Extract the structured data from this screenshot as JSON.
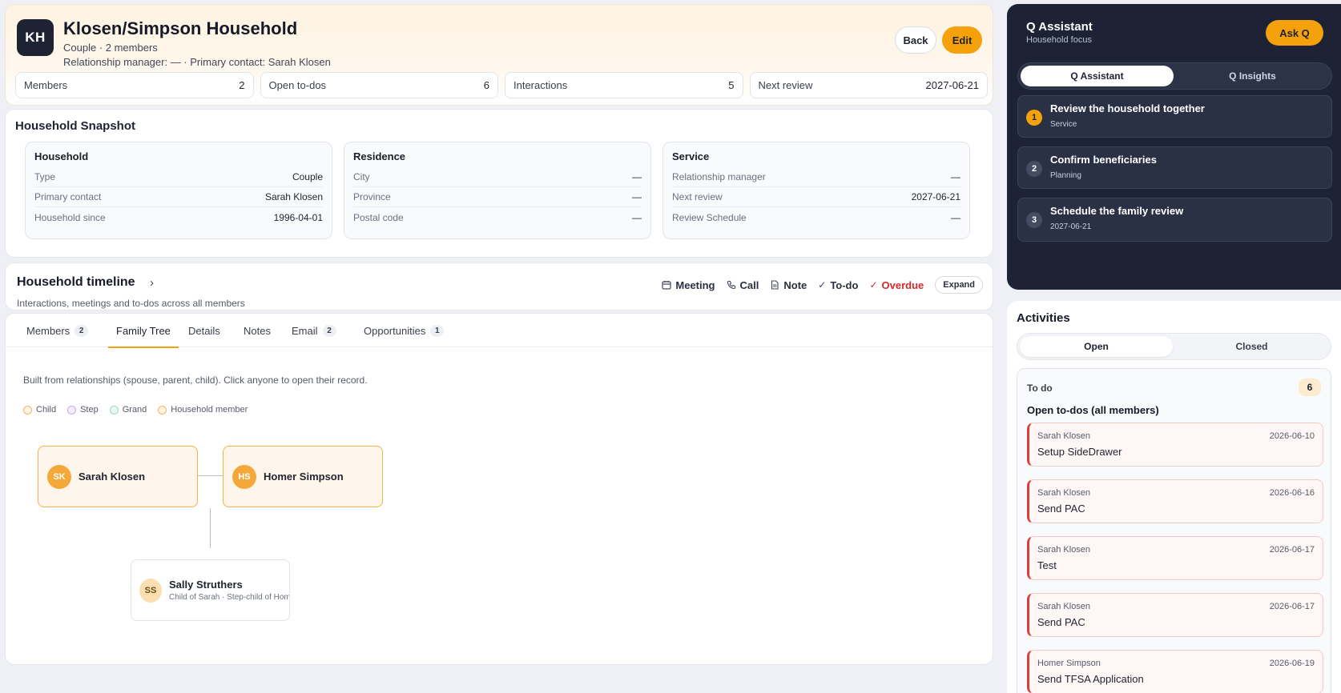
{
  "header": {
    "initials": "KH",
    "title": "Klosen/Simpson Household",
    "subtitle": "Couple · 2 members",
    "subtitle2": "Relationship manager: — · Primary contact: Sarah Klosen",
    "back_label": "Back",
    "edit_label": "Edit"
  },
  "stats": [
    {
      "label": "Members",
      "value": "2"
    },
    {
      "label": "Open to-dos",
      "value": "6"
    },
    {
      "label": "Interactions",
      "value": "5"
    },
    {
      "label": "Next review",
      "value": "2027-06-21"
    }
  ],
  "snapshot": {
    "title": "Household Snapshot",
    "cards": [
      {
        "title": "Household",
        "rows": [
          {
            "k": "Type",
            "v": "Couple"
          },
          {
            "k": "Primary contact",
            "v": "Sarah Klosen"
          },
          {
            "k": "Household since",
            "v": "1996-04-01"
          }
        ]
      },
      {
        "title": "Residence",
        "rows": [
          {
            "k": "City",
            "v": "—"
          },
          {
            "k": "Province",
            "v": "—"
          },
          {
            "k": "Postal code",
            "v": "—"
          }
        ]
      },
      {
        "title": "Service",
        "rows": [
          {
            "k": "Relationship manager",
            "v": "—"
          },
          {
            "k": "Next review",
            "v": "2027-06-21"
          },
          {
            "k": "Review Schedule",
            "v": "—"
          }
        ]
      }
    ]
  },
  "timeline": {
    "title": "Household timeline",
    "subtitle": "Interactions, meetings and to-dos across all members",
    "filters": [
      {
        "label": "Meeting",
        "icon": "calendar-icon"
      },
      {
        "label": "Call",
        "icon": "phone-icon"
      },
      {
        "label": "Note",
        "icon": "note-icon"
      },
      {
        "label": "To-do",
        "icon": "check-icon"
      },
      {
        "label": "Overdue",
        "icon": "check-icon"
      }
    ],
    "expand_label": "Expand"
  },
  "tabs": [
    {
      "label": "Members",
      "badge": "2"
    },
    {
      "label": "Family Tree",
      "badge": ""
    },
    {
      "label": "Details",
      "badge": ""
    },
    {
      "label": "Notes",
      "badge": ""
    },
    {
      "label": "Email",
      "badge": "2"
    },
    {
      "label": "Opportunities",
      "badge": "1"
    }
  ],
  "family_tree": {
    "description": "Built from relationships (spouse, parent, child). Click anyone to open their record.",
    "legend": [
      {
        "label": "Child",
        "color": "#f5b35c"
      },
      {
        "label": "Step",
        "color": "#c9a7e8"
      },
      {
        "label": "Grand",
        "color": "#9fd6be"
      },
      {
        "label": "Household member",
        "color": "#f5b35c"
      }
    ],
    "members": [
      {
        "initials": "SK",
        "name": "Sarah Klosen"
      },
      {
        "initials": "HS",
        "name": "Homer Simpson"
      }
    ],
    "child": {
      "initials": "SS",
      "name": "Sally Struthers",
      "relation": "Child of Sarah · Step-child of Homer"
    }
  },
  "assistant": {
    "title": "Q Assistant",
    "subtitle": "Household focus",
    "ask_label": "Ask Q",
    "tabs": [
      "Q Assistant",
      "Q Insights"
    ],
    "items": [
      {
        "num": "1",
        "title": "Review the household together",
        "sub": "Service"
      },
      {
        "num": "2",
        "title": "Confirm beneficiaries",
        "sub": "Planning"
      },
      {
        "num": "3",
        "title": "Schedule the family review",
        "sub": "2027-06-21"
      }
    ]
  },
  "activities": {
    "title": "Activities",
    "tabs": [
      "Open",
      "Closed"
    ],
    "todo_label": "To do",
    "todo_count": "6",
    "todo_heading": "Open to-dos (all members)",
    "todos": [
      {
        "who": "Sarah Klosen",
        "date": "2026-06-10",
        "title": "Setup SideDrawer"
      },
      {
        "who": "Sarah Klosen",
        "date": "2026-06-16",
        "title": "Send PAC"
      },
      {
        "who": "Sarah Klosen",
        "date": "2026-06-17",
        "title": "Test"
      },
      {
        "who": "Sarah Klosen",
        "date": "2026-06-17",
        "title": "Send PAC"
      },
      {
        "who": "Homer Simpson",
        "date": "2026-06-19",
        "title": "Send TFSA Application"
      }
    ]
  },
  "colors": {
    "accent": "#f5a10c",
    "dark_panel": "#1d2334",
    "overdue": "#d22b2b"
  }
}
